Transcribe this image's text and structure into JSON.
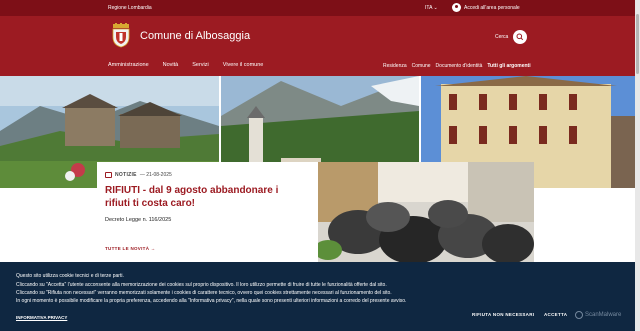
{
  "topbar": {
    "region": "Regione Lombardia",
    "lang": "ITA",
    "login": "Accedi all'area personale"
  },
  "header": {
    "site_name": "Comune di Albosaggia",
    "search_label": "Cerca",
    "nav_main": [
      "Amministrazione",
      "Novità",
      "Servizi",
      "Vivere il comune"
    ],
    "nav_sub": [
      "Residenza",
      "Comune",
      "Documento d'identità",
      "Tutti gli argomenti"
    ]
  },
  "news": {
    "category": "NOTIZIE",
    "date": "— 21-08-2025",
    "title": "RIFIUTI - dal 9 agosto abbandonare i rifiuti ti costa caro!",
    "subtitle": "Decreto Legge n. 116/2025",
    "all_news": "TUTTE LE NOVITÀ →"
  },
  "cookie": {
    "line1": "Questo sito utilizza cookie tecnici e di terze parti.",
    "line2": "Cliccando su \"Accetta\" l'utente acconsente alla memorizzazione dei cookies sul proprio dispositivo. Il loro utilizzo permette di fruire di tutte le funzionalità offerte dal sito.",
    "line3": "Cliccando su \"Rifiuta non necessari\" verranno memorizzati solamente i cookies di carattere tecnico, ovvero quei cookies strettamente necessari al funzionamento del sito.",
    "line4": "In ogni momento è possibile modificare la propria preferenza, accedendo alla \"Informativa privacy\", nella quale sono presenti ulteriori informazioni a corredo del presente avviso.",
    "policy_link": "INFORMATIVA PRIVACY",
    "deny_button": "RIFIUTA NON NECESSARI",
    "accept_button": "ACCETTA",
    "brand": "ScanMalware"
  },
  "colors": {
    "brand": "#9c1b22",
    "topbar": "#7d0f17",
    "cookie_bg": "#0f2741"
  },
  "icons": [
    "crest-logo",
    "user-icon",
    "search-icon",
    "calendar-icon",
    "chevron-down-icon"
  ]
}
